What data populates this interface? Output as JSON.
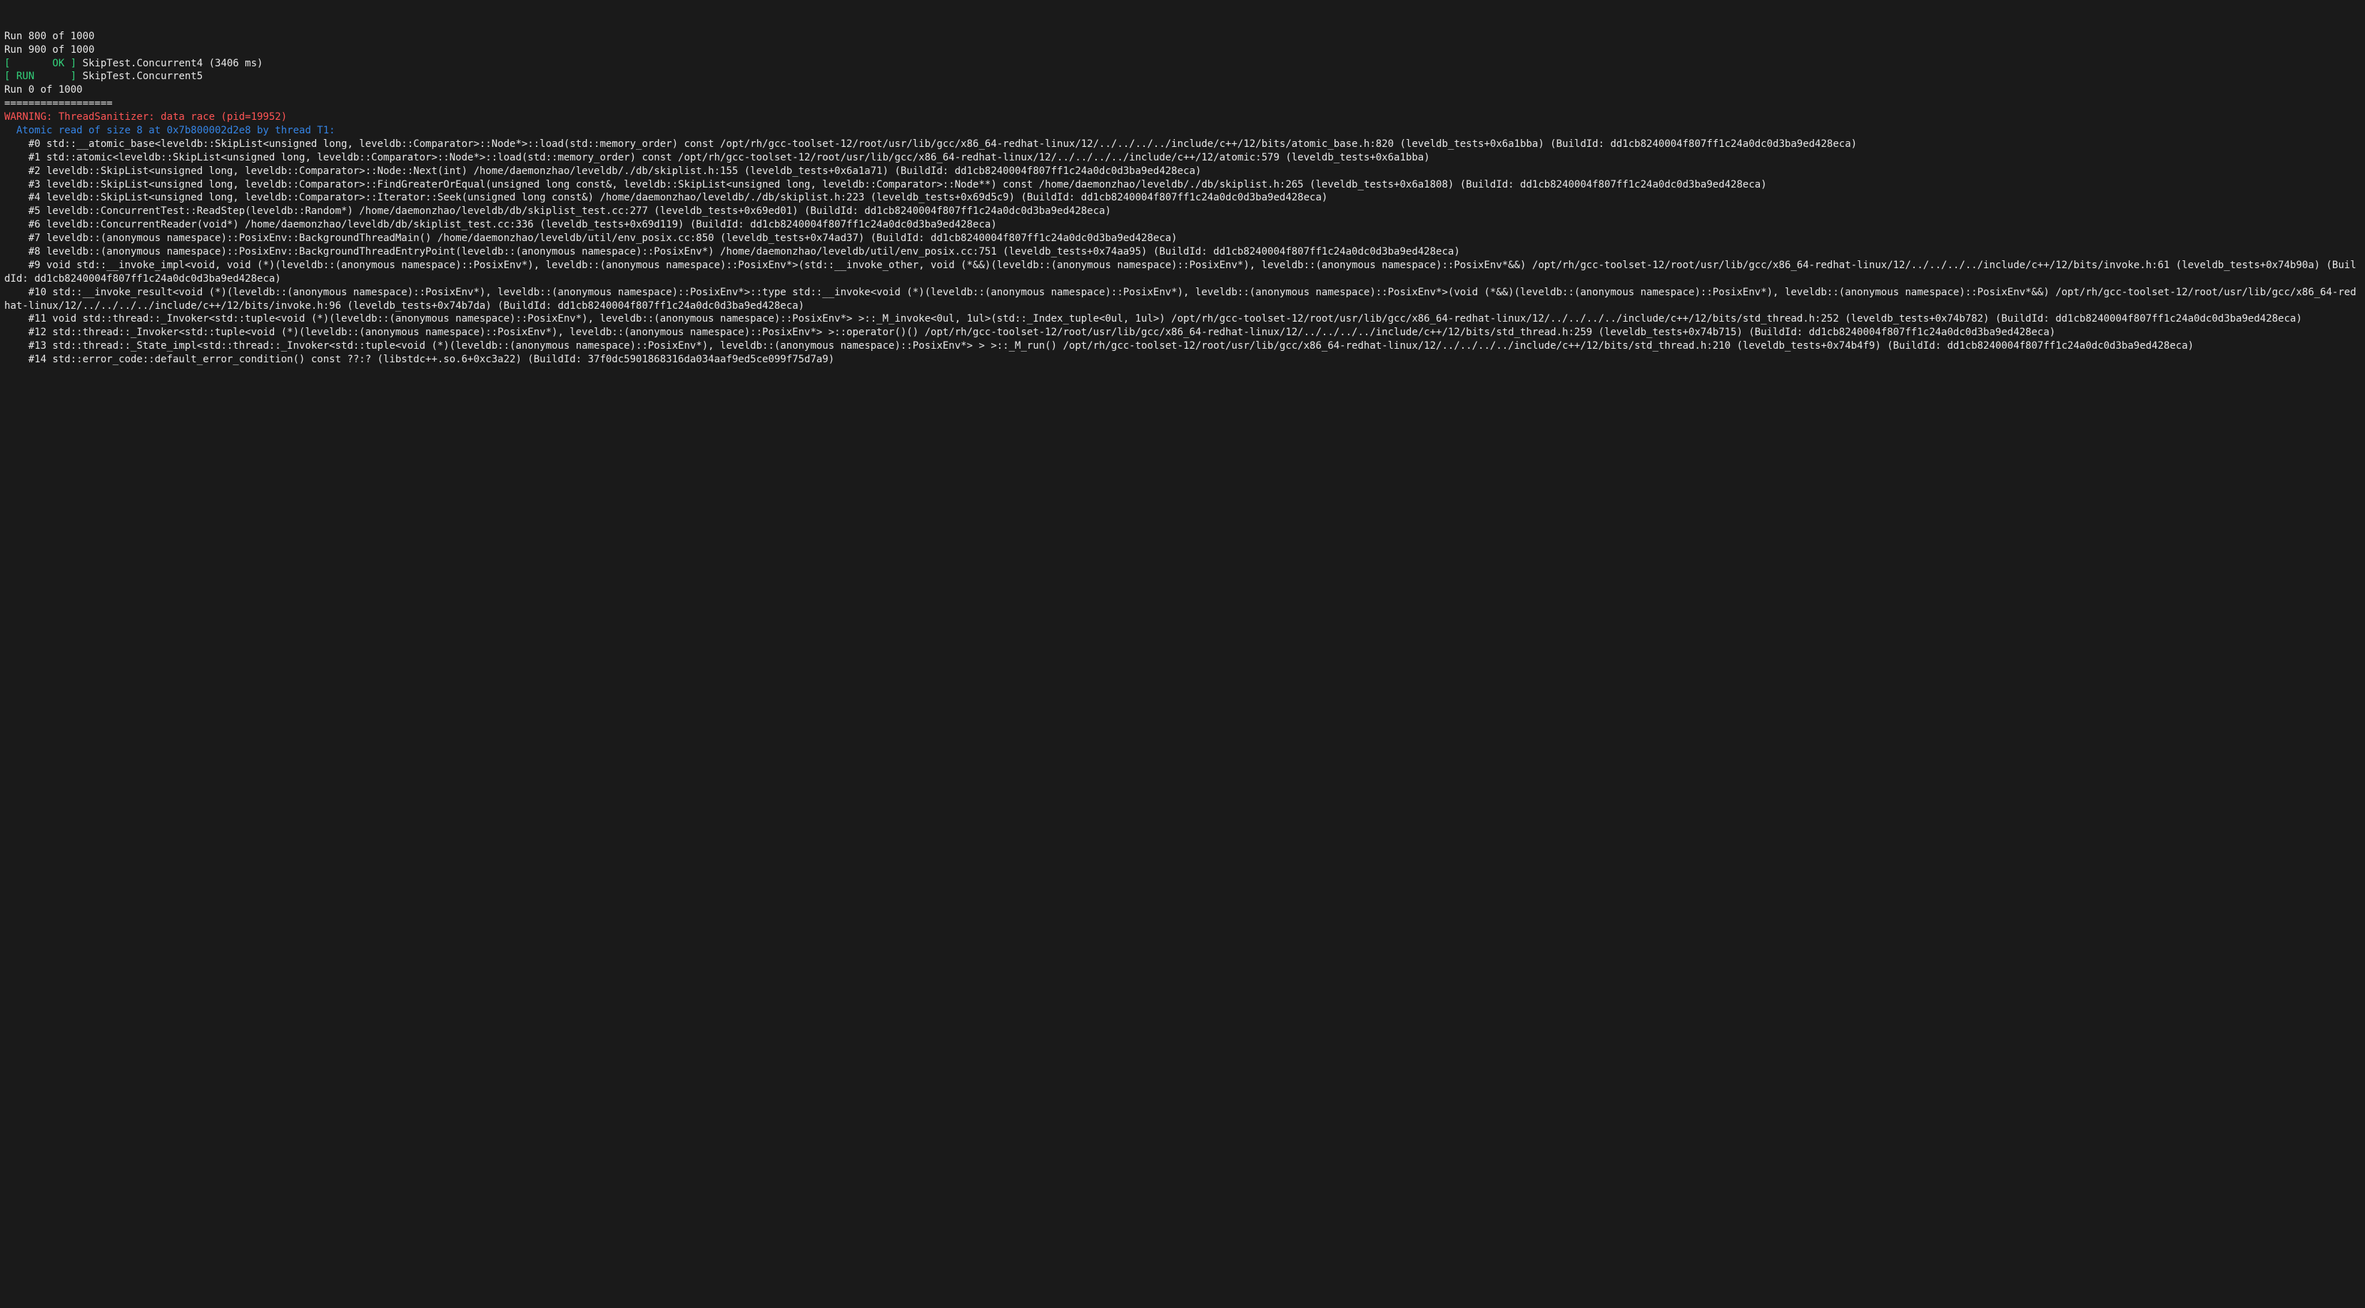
{
  "log": {
    "run800": "Run 800 of 1000",
    "run900": "Run 900 of 1000",
    "ok_tag": "[       OK ]",
    "ok_test": "SkipTest.Concurrent4 (3406 ms)",
    "run_tag": "[ RUN      ]",
    "run_test": "SkipTest.Concurrent5",
    "run0": "Run 0 of 1000",
    "sep": "==================",
    "warning": "WARNING: ThreadSanitizer: data race (pid=19952)",
    "atomic_read": "  Atomic read of size 8 at 0x7b800002d2e8 by thread T1:",
    "frames": [
      "    #0 std::__atomic_base<leveldb::SkipList<unsigned long, leveldb::Comparator>::Node*>::load(std::memory_order) const /opt/rh/gcc-toolset-12/root/usr/lib/gcc/x86_64-redhat-linux/12/../../../../include/c++/12/bits/atomic_base.h:820 (leveldb_tests+0x6a1bba) (BuildId: dd1cb8240004f807ff1c24a0dc0d3ba9ed428eca)",
      "    #1 std::atomic<leveldb::SkipList<unsigned long, leveldb::Comparator>::Node*>::load(std::memory_order) const /opt/rh/gcc-toolset-12/root/usr/lib/gcc/x86_64-redhat-linux/12/../../../../include/c++/12/atomic:579 (leveldb_tests+0x6a1bba)",
      "    #2 leveldb::SkipList<unsigned long, leveldb::Comparator>::Node::Next(int) /home/daemonzhao/leveldb/./db/skiplist.h:155 (leveldb_tests+0x6a1a71) (BuildId: dd1cb8240004f807ff1c24a0dc0d3ba9ed428eca)",
      "    #3 leveldb::SkipList<unsigned long, leveldb::Comparator>::FindGreaterOrEqual(unsigned long const&, leveldb::SkipList<unsigned long, leveldb::Comparator>::Node**) const /home/daemonzhao/leveldb/./db/skiplist.h:265 (leveldb_tests+0x6a1808) (BuildId: dd1cb8240004f807ff1c24a0dc0d3ba9ed428eca)",
      "    #4 leveldb::SkipList<unsigned long, leveldb::Comparator>::Iterator::Seek(unsigned long const&) /home/daemonzhao/leveldb/./db/skiplist.h:223 (leveldb_tests+0x69d5c9) (BuildId: dd1cb8240004f807ff1c24a0dc0d3ba9ed428eca)",
      "    #5 leveldb::ConcurrentTest::ReadStep(leveldb::Random*) /home/daemonzhao/leveldb/db/skiplist_test.cc:277 (leveldb_tests+0x69ed01) (BuildId: dd1cb8240004f807ff1c24a0dc0d3ba9ed428eca)",
      "    #6 leveldb::ConcurrentReader(void*) /home/daemonzhao/leveldb/db/skiplist_test.cc:336 (leveldb_tests+0x69d119) (BuildId: dd1cb8240004f807ff1c24a0dc0d3ba9ed428eca)",
      "    #7 leveldb::(anonymous namespace)::PosixEnv::BackgroundThreadMain() /home/daemonzhao/leveldb/util/env_posix.cc:850 (leveldb_tests+0x74ad37) (BuildId: dd1cb8240004f807ff1c24a0dc0d3ba9ed428eca)",
      "    #8 leveldb::(anonymous namespace)::PosixEnv::BackgroundThreadEntryPoint(leveldb::(anonymous namespace)::PosixEnv*) /home/daemonzhao/leveldb/util/env_posix.cc:751 (leveldb_tests+0x74aa95) (BuildId: dd1cb8240004f807ff1c24a0dc0d3ba9ed428eca)",
      "    #9 void std::__invoke_impl<void, void (*)(leveldb::(anonymous namespace)::PosixEnv*), leveldb::(anonymous namespace)::PosixEnv*>(std::__invoke_other, void (*&&)(leveldb::(anonymous namespace)::PosixEnv*), leveldb::(anonymous namespace)::PosixEnv*&&) /opt/rh/gcc-toolset-12/root/usr/lib/gcc/x86_64-redhat-linux/12/../../../../include/c++/12/bits/invoke.h:61 (leveldb_tests+0x74b90a) (BuildId: dd1cb8240004f807ff1c24a0dc0d3ba9ed428eca)",
      "    #10 std::__invoke_result<void (*)(leveldb::(anonymous namespace)::PosixEnv*), leveldb::(anonymous namespace)::PosixEnv*>::type std::__invoke<void (*)(leveldb::(anonymous namespace)::PosixEnv*), leveldb::(anonymous namespace)::PosixEnv*>(void (*&&)(leveldb::(anonymous namespace)::PosixEnv*), leveldb::(anonymous namespace)::PosixEnv*&&) /opt/rh/gcc-toolset-12/root/usr/lib/gcc/x86_64-redhat-linux/12/../../../../include/c++/12/bits/invoke.h:96 (leveldb_tests+0x74b7da) (BuildId: dd1cb8240004f807ff1c24a0dc0d3ba9ed428eca)",
      "    #11 void std::thread::_Invoker<std::tuple<void (*)(leveldb::(anonymous namespace)::PosixEnv*), leveldb::(anonymous namespace)::PosixEnv*> >::_M_invoke<0ul, 1ul>(std::_Index_tuple<0ul, 1ul>) /opt/rh/gcc-toolset-12/root/usr/lib/gcc/x86_64-redhat-linux/12/../../../../include/c++/12/bits/std_thread.h:252 (leveldb_tests+0x74b782) (BuildId: dd1cb8240004f807ff1c24a0dc0d3ba9ed428eca)",
      "    #12 std::thread::_Invoker<std::tuple<void (*)(leveldb::(anonymous namespace)::PosixEnv*), leveldb::(anonymous namespace)::PosixEnv*> >::operator()() /opt/rh/gcc-toolset-12/root/usr/lib/gcc/x86_64-redhat-linux/12/../../../../include/c++/12/bits/std_thread.h:259 (leveldb_tests+0x74b715) (BuildId: dd1cb8240004f807ff1c24a0dc0d3ba9ed428eca)",
      "    #13 std::thread::_State_impl<std::thread::_Invoker<std::tuple<void (*)(leveldb::(anonymous namespace)::PosixEnv*), leveldb::(anonymous namespace)::PosixEnv*> > >::_M_run() /opt/rh/gcc-toolset-12/root/usr/lib/gcc/x86_64-redhat-linux/12/../../../../include/c++/12/bits/std_thread.h:210 (leveldb_tests+0x74b4f9) (BuildId: dd1cb8240004f807ff1c24a0dc0d3ba9ed428eca)",
      "    #14 std::error_code::default_error_condition() const ??:? (libstdc++.so.6+0xc3a22) (BuildId: 37f0dc5901868316da034aaf9ed5ce099f75d7a9)"
    ]
  }
}
